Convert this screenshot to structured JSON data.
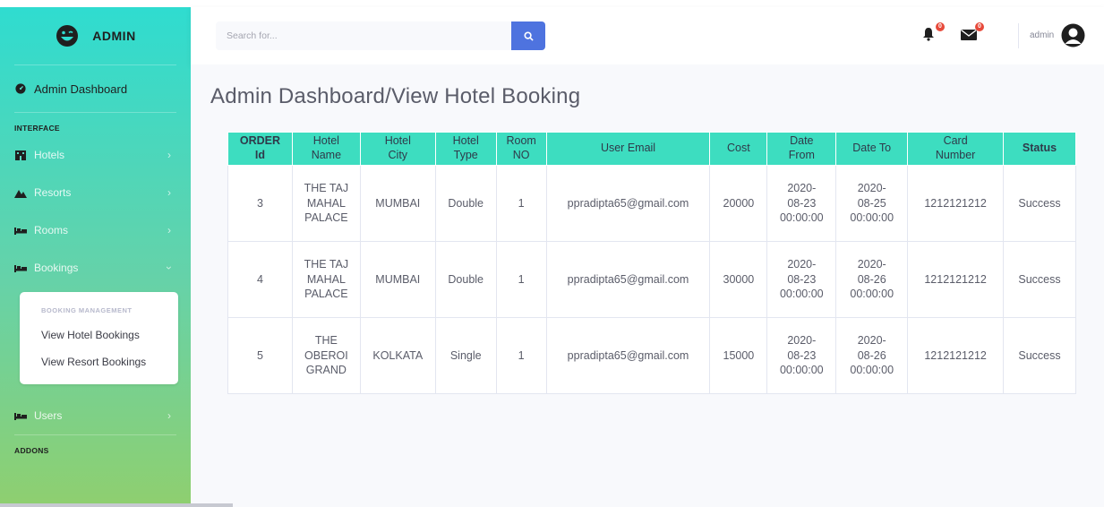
{
  "brand": {
    "name": "ADMIN"
  },
  "sidebar": {
    "dashboard_label": "Admin Dashboard",
    "interface_heading": "INTERFACE",
    "items": [
      {
        "label": "Hotels",
        "icon": "hotel-icon"
      },
      {
        "label": "Resorts",
        "icon": "resort-icon"
      },
      {
        "label": "Rooms",
        "icon": "bed-icon"
      },
      {
        "label": "Bookings",
        "icon": "bed-icon",
        "expanded": true
      }
    ],
    "bookings_submenu": {
      "header": "BOOKING MANAGEMENT",
      "items": [
        "View Hotel Bookings",
        "View Resort Bookings"
      ]
    },
    "users_label": "Users",
    "addons_heading": "ADDONS"
  },
  "topbar": {
    "search_placeholder": "Search for...",
    "alerts_count": "0",
    "messages_count": "0",
    "user_name": "admin"
  },
  "page": {
    "title": "Admin Dashboard/View Hotel Booking"
  },
  "table": {
    "headers": [
      [
        "ORDER",
        "Id"
      ],
      [
        "Hotel",
        "Name"
      ],
      [
        "Hotel",
        "City"
      ],
      [
        "Hotel",
        "Type"
      ],
      [
        "Room",
        "NO"
      ],
      [
        "User Email"
      ],
      [
        "Cost"
      ],
      [
        "Date",
        "From"
      ],
      [
        "Date To"
      ],
      [
        "Card",
        "Number"
      ],
      [
        "Status"
      ]
    ],
    "rows": [
      {
        "order_id": "3",
        "hotel_name": [
          "THE TAJ",
          "MAHAL",
          "PALACE"
        ],
        "hotel_city": "MUMBAI",
        "hotel_type": "Double",
        "room_no": "1",
        "user_email": "ppradipta65@gmail.com",
        "cost": "20000",
        "date_from": [
          "2020-",
          "08-23",
          "00:00:00"
        ],
        "date_to": [
          "2020-",
          "08-25",
          "00:00:00"
        ],
        "card_number": "1212121212",
        "status": "Success"
      },
      {
        "order_id": "4",
        "hotel_name": [
          "THE TAJ",
          "MAHAL",
          "PALACE"
        ],
        "hotel_city": "MUMBAI",
        "hotel_type": "Double",
        "room_no": "1",
        "user_email": "ppradipta65@gmail.com",
        "cost": "30000",
        "date_from": [
          "2020-",
          "08-23",
          "00:00:00"
        ],
        "date_to": [
          "2020-",
          "08-26",
          "00:00:00"
        ],
        "card_number": "1212121212",
        "status": "Success"
      },
      {
        "order_id": "5",
        "hotel_name": [
          "THE",
          "OBEROI",
          "GRAND"
        ],
        "hotel_city": "KOLKATA",
        "hotel_type": "Single",
        "room_no": "1",
        "user_email": "ppradipta65@gmail.com",
        "cost": "15000",
        "date_from": [
          "2020-",
          "08-23",
          "00:00:00"
        ],
        "date_to": [
          "2020-",
          "08-26",
          "00:00:00"
        ],
        "card_number": "1212121212",
        "status": "Success"
      }
    ]
  },
  "colors": {
    "sidebar_top": "#2fdcd0",
    "sidebar_bottom": "#8fcf6f",
    "table_header": "#3dddc0",
    "search_button": "#4e73df",
    "badge": "#e74a3b"
  }
}
